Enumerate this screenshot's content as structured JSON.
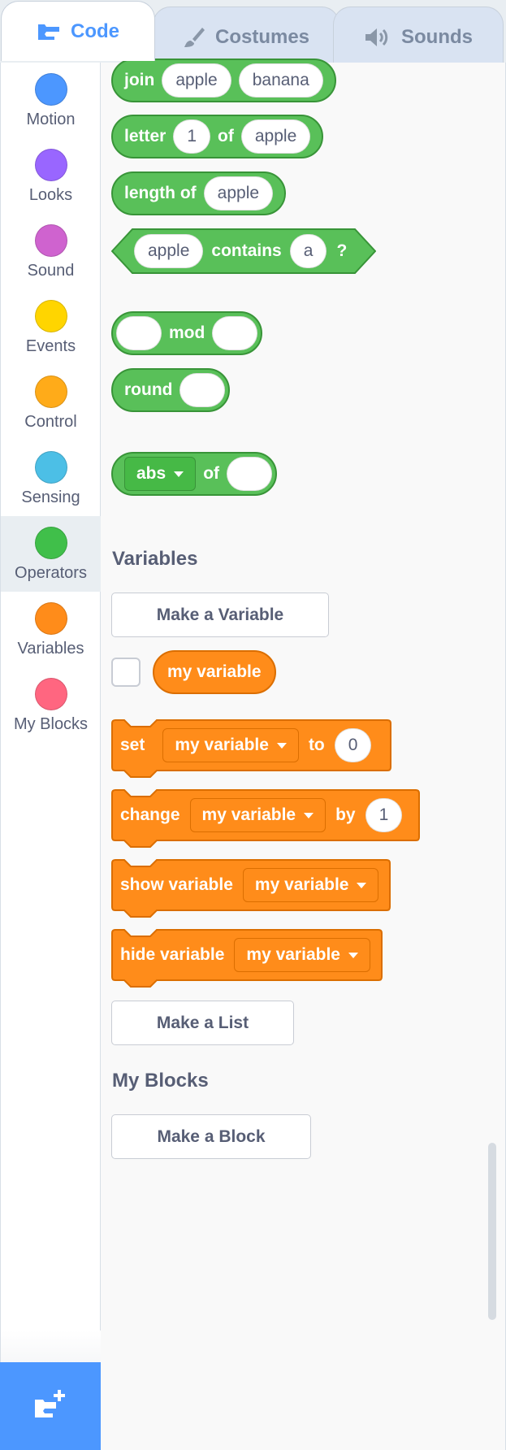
{
  "tabs": [
    {
      "label": "Code",
      "icon": "code-blocks-icon"
    },
    {
      "label": "Costumes",
      "icon": "brush-icon"
    },
    {
      "label": "Sounds",
      "icon": "speaker-icon"
    }
  ],
  "categories": [
    {
      "label": "Motion",
      "color": "#4c97ff"
    },
    {
      "label": "Looks",
      "color": "#9966ff"
    },
    {
      "label": "Sound",
      "color": "#cf63cf"
    },
    {
      "label": "Events",
      "color": "#ffd500"
    },
    {
      "label": "Control",
      "color": "#ffab19"
    },
    {
      "label": "Sensing",
      "color": "#4cbfe6"
    },
    {
      "label": "Operators",
      "color": "#40bf4a"
    },
    {
      "label": "Variables",
      "color": "#ff8c1a"
    },
    {
      "label": "My Blocks",
      "color": "#ff6680"
    }
  ],
  "selected_category": "Operators",
  "operators": {
    "join": {
      "label": "join",
      "arg1": "apple",
      "arg2": "banana"
    },
    "letter": {
      "label": "letter",
      "index": "1",
      "of": "of",
      "text": "apple"
    },
    "length": {
      "label": "length of",
      "text": "apple"
    },
    "contains": {
      "text": "apple",
      "label": "contains",
      "char": "a",
      "suffix": "?"
    },
    "mod": {
      "label": "mod"
    },
    "round": {
      "label": "round"
    },
    "abs": {
      "func": "abs",
      "of": "of"
    }
  },
  "variables": {
    "title": "Variables",
    "make_variable": "Make a Variable",
    "variable_name": "my variable",
    "set": {
      "label": "set",
      "var": "my variable",
      "to": "to",
      "value": "0"
    },
    "change": {
      "label": "change",
      "var": "my variable",
      "by": "by",
      "value": "1"
    },
    "show": {
      "label": "show variable",
      "var": "my variable"
    },
    "hide": {
      "label": "hide variable",
      "var": "my variable"
    },
    "make_list": "Make a List"
  },
  "my_blocks": {
    "title": "My Blocks",
    "make_block": "Make a Block"
  },
  "colors": {
    "operators": "#59c059",
    "variables": "#ff8c1a",
    "accent": "#4c97ff"
  }
}
